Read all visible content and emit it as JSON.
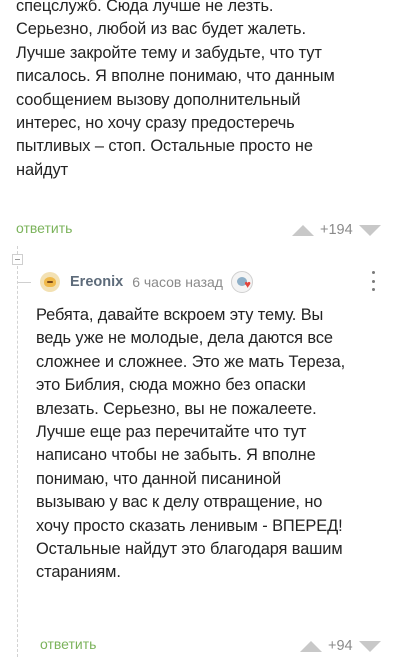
{
  "comment_1": {
    "text_lines": [
      "спецслужб. Сюда лучше не лезть.",
      "Серьезно, любой из вас будет жалеть.",
      "Лучше закройте тему и забудьте, что тут",
      "писалось. Я вполне понимаю, что данным",
      "сообщением вызову дополнительный",
      "интерес, но хочу сразу предостеречь",
      "пытливых – стоп. Остальные просто не",
      "найдут"
    ],
    "reply_label": "ответить",
    "score": "+194"
  },
  "comment_2": {
    "author": "Ereonix",
    "time": "6 часов назад",
    "text_lines": [
      "Ребята, давайте вскроем эту тему. Вы",
      "ведь уже не молодые, дела даются все",
      "сложнее и сложнее. Это же мать Тереза,",
      "это Библия, сюда можно без опаски",
      "влезать. Серьезно, вы не пожалеете.",
      "Лучше еще раз перечитайте что тут",
      "написано чтобы не забыть. Я вполне",
      "понимаю, что данной писаниной",
      "вызываю у вас к делу отвращение, но",
      "хочу просто сказать ленивым - ВПЕРЕД!",
      "Остальные найдут это благодаря вашим",
      "стараниям."
    ],
    "reply_label": "ответить",
    "score": "+94"
  },
  "icons": {
    "upvote": "arrow-up-icon",
    "downvote": "arrow-down-icon",
    "collapse": "collapse-minus-icon",
    "menu": "more-vertical-icon",
    "badge": "award-heart-icon",
    "avatar": "user-avatar"
  },
  "colors": {
    "reply_link": "#7bb35b",
    "score": "#8a8a8a",
    "author": "#5d6b7a",
    "vote_arrows": "#c8c8c8"
  }
}
